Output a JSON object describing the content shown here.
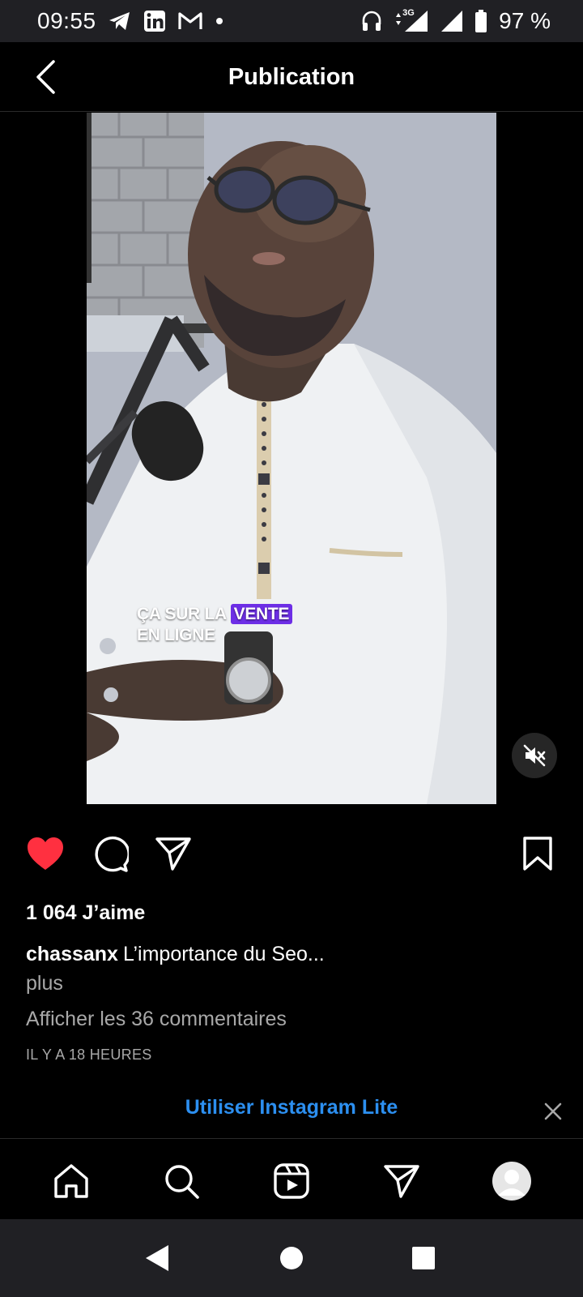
{
  "status_bar": {
    "time": "09:55",
    "battery": "97 %",
    "network": "3G",
    "left_icons": [
      "telegram-icon",
      "linkedin-icon",
      "gmail-icon",
      "dot-icon"
    ],
    "right_icons": [
      "headphones-icon",
      "data-arrows-icon",
      "signal-icon",
      "signal-icon",
      "battery-icon"
    ]
  },
  "app_bar": {
    "title": "Publication",
    "back_icon": "chevron-left-icon"
  },
  "post": {
    "video_caption_line1": "ÇA SUR LA",
    "video_caption_highlight": "VENTE",
    "video_caption_line2": "EN LIGNE",
    "highlight_color": "#6d2ee6",
    "mute_icon": "volume-muted-icon",
    "liked": true,
    "like_color": "#ff3040",
    "likes": "1 064 J’aime",
    "username": "chassanx",
    "caption": "L’importance du Seo...",
    "more": "plus",
    "comments": "Afficher les 36 commentaires",
    "timestamp": "IL Y A 18 HEURES"
  },
  "banner": {
    "label": "Utiliser Instagram Lite",
    "link_color": "#2c8ff0"
  },
  "bottom_nav": {
    "items": [
      "home-icon",
      "search-icon",
      "reels-icon",
      "direct-icon",
      "profile-avatar"
    ]
  },
  "system_nav": {
    "items": [
      "back-triangle-icon",
      "home-circle-icon",
      "recents-square-icon"
    ]
  }
}
